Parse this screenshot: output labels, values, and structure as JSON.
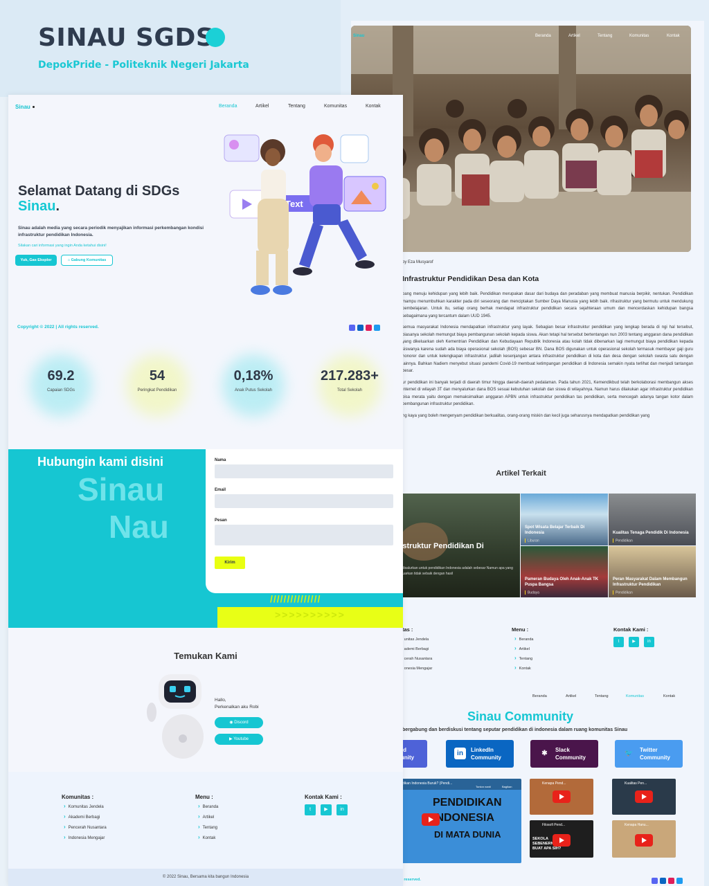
{
  "brand": {
    "title": "SINAU SGDS",
    "subtitle": "DepokPride - Politeknik Negeri Jakarta",
    "accent": "#1bd0d6"
  },
  "left": {
    "nav": {
      "logo": "Sinau",
      "items": [
        "Beranda",
        "Artikel",
        "Tentang",
        "Komunitas",
        "Kontak"
      ]
    },
    "hero": {
      "title_line1": "Selamat Datang di SDGs",
      "title_line2": "Sinau",
      "title_dot": ".",
      "desc": "Sinau adalah media yang secara periodik menyajikan informasi perkembangan kondisi infrastruktur pendidikan Indonesia.",
      "hint": "Silakan cari informasi yang ingin Anda ketahui disini!",
      "btn_primary": "Yuk, Gas Eksplor",
      "btn_secondary": "Gabung Komunitas",
      "illus_text": "Text"
    },
    "copyright": "Copyright © 2022 | All rights reserved.",
    "stats": [
      {
        "value": "69.2",
        "label": "Capaian SDGs",
        "glow": "#8ee6ee"
      },
      {
        "value": "54",
        "label": "Peringkat Pendidikan",
        "glow": "#f0f7a0"
      },
      {
        "value": "0,18%",
        "label": "Anak Putus Sekolah",
        "glow": "#8ee6ee"
      },
      {
        "value": "217.283+",
        "label": "Total Sekolah",
        "glow": "#f0f7a0"
      }
    ],
    "contact": {
      "title": "Hubungin kami disini",
      "big1": "Sinau",
      "big2": "Nau",
      "fields": [
        "Nama",
        "Email",
        "Pesan"
      ],
      "send": "Kirim",
      "slashes": "///////////////",
      "arrows": ">>>>>>>>>>"
    },
    "find": {
      "title": "Temukan Kami",
      "hello1": "Hallo,",
      "hello2": "Perkenalkan aku Robi",
      "btn1": "Discord",
      "btn2": "Youtube"
    },
    "footer": {
      "komunitas_h": "Komunitas :",
      "komunitas": [
        "Komunitas Jendela",
        "Akademi Berbagi",
        "Pencerah Nusantara",
        "Indonesia Mengajar"
      ],
      "menu_h": "Menu :",
      "menu": [
        "Beranda",
        "Artikel",
        "Tentang",
        "Kontak"
      ],
      "kontak_h": "Kontak Kami :",
      "bottom": "© 2022 Sinau, Bersama kita bangun Indonesia"
    }
  },
  "right": {
    "photo_nav": {
      "logo": "Sinau",
      "items": [
        "Beranda",
        "Artikel",
        "Tentang",
        "Komunitas",
        "Kontak"
      ]
    },
    "caption": "by Eza Musyarof",
    "article_title": "Infrastruktur Pendidikan Desa dan Kota",
    "paragraphs": [
      "pang menuju kehidupan yang lebih baik. Pendidikan merupakan dasar dari budaya dan peradaban yang membuat manusia berpikir, nentukan. Pendidikan mampu menumbuhkan karakter pada diri seseorang dan menciptakan Sumber Daya Manusia yang lebih baik. nfrastruktur yang bermutu untuk mendukung pembelajaran. Untuk itu, setiap orang berhak mendapat infrastruktur pendidikan secara sejahteraan umum dan mencerdaskan kehidupan bangsa sebagaimana yang tercantum dalam UUD 1945.",
      "semua masyarakat Indonesia mendapatkan infrastruktur yang layak. Sebagian besar infrastruktur pendidikan yang lengkap berada di ngi hal tersebut, biasanya sekolah memungut biaya pembangunan sekolah kepada siswa. Akan tetapi hal tersebut bertentangan nun 2003 tentang anggaran dana pendidikan yang dikeluarkan oleh Kementrian Pendidikan dan Kebudayaan Republik Indonesia atau kolah tidak dibenarkan lagi memungut biaya pendidikan kepada siswanya karena sudah ada biaya operasional sekolah (BOS) sebesar BN. Dana BOS digunakan untuk operasional sekolah termasuk membayar gaji guru honorer dan untuk kelengkapan infrastruktur. jadilah kesenjangan antara infrastruktur pendidikan di kota dan desa dengan sekolah swasta satu dengan lainnya. Bahkan Nadiem menyebut situasi pandemi Covid-19 membuat ketimpangan pendidikan di Indonesia semakin nyata terlihat dan menjadi tantangan besar.",
      "ur pendidikan ini banyak terjadi di daerah timur hingga daerah-daerah pedalaman. Pada tahun 2021, Kemendikbud telah berkolaborasi membangun akses internet di wilayah 3T dan menyalurkan dana BOS sesuai kebutuhan sekolah dan siswa di wilayahnya. Namun harus dilakukan agar infrastruktur pendidikan bisa merata yaitu dengan memaksimalkan anggaran APBN untuk infrastruktur pendidikan tas pendidikan, serta mencegah adanya tangan kotor dalam pembangunan infrastruktur pendidikan.",
      "ng kaya yang boleh mengenyam pendidikan berkualitas, orang-orang miskin dan kecil juga seharusnya mendapatkan pendidikan yang"
    ],
    "related_title": "Artikel Terkait",
    "related": [
      {
        "title": "rastruktur Pendidikan Di",
        "desc": "ang disalurkan untuk pendidikan Indonesia adalah sebesar Namun apa yang dikeluarkan tidak sebaik dengan hasil"
      },
      {
        "title": "Spot Wisata Belajar Terbaik Di Indonesia",
        "cat": "Liburan"
      },
      {
        "title": "Kualitas Tenaga Pendidik Di Indonesia",
        "cat": "Pendidikan"
      },
      {
        "title": "Pameran Budaya Oleh Anak-Anak TK Puspa Bangsa",
        "cat": "Budaya"
      },
      {
        "title": "Peran Masyarakat Dalam Membangun Infrastruktur Pendidikan",
        "cat": "Pendidikan"
      }
    ],
    "footer": {
      "komunitas_h": "tas :",
      "komunitas": [
        "unitas Jendela",
        "ademi Berbagi",
        "cerah Nusantara",
        "onesia Mengajar"
      ],
      "menu_h": "Menu :",
      "menu": [
        "Beranda",
        "Artikel",
        "Tentang",
        "Kontak"
      ],
      "kontak_h": "Kontak Kami :"
    },
    "nav2": [
      "Beranda",
      "Artikel",
      "Tentang",
      "Komunitas",
      "Kontak"
    ],
    "community": {
      "title": "Sinau Community",
      "subtitle": "bergabung dan berdiskusi tentang seputar pendidikan di indonesia dalam ruang komunitas Sinau",
      "buttons": [
        {
          "l1": "rd",
          "l2": "unity",
          "color": "#4e62d8"
        },
        {
          "l1": "LinkedIn",
          "l2": "Community",
          "color": "#0a66c2"
        },
        {
          "l1": "Slack",
          "l2": "Community",
          "color": "#4a154b"
        },
        {
          "l1": "Twitter",
          "l2": "Community",
          "color": "#4a9cf0"
        }
      ]
    },
    "videos": {
      "main_title": "dikan Indonesia Buruk? (Pendi...",
      "main_big1": "PENDIDIKAN",
      "main_big2": "INDONESIA",
      "main_big3": "DI MATA DUNIA",
      "main_later": "Tonton nanti",
      "main_share": "Bagikan",
      "v1": "Kenapa Pend...",
      "v2": "Filosofi Pend...",
      "v3": "Kualitas Pen...",
      "v4": "Kenapa Hanu...",
      "v2_big": "SEKOLA SEBENERNYA BUAT APA SIH?"
    },
    "copyright": "ts reserved."
  }
}
